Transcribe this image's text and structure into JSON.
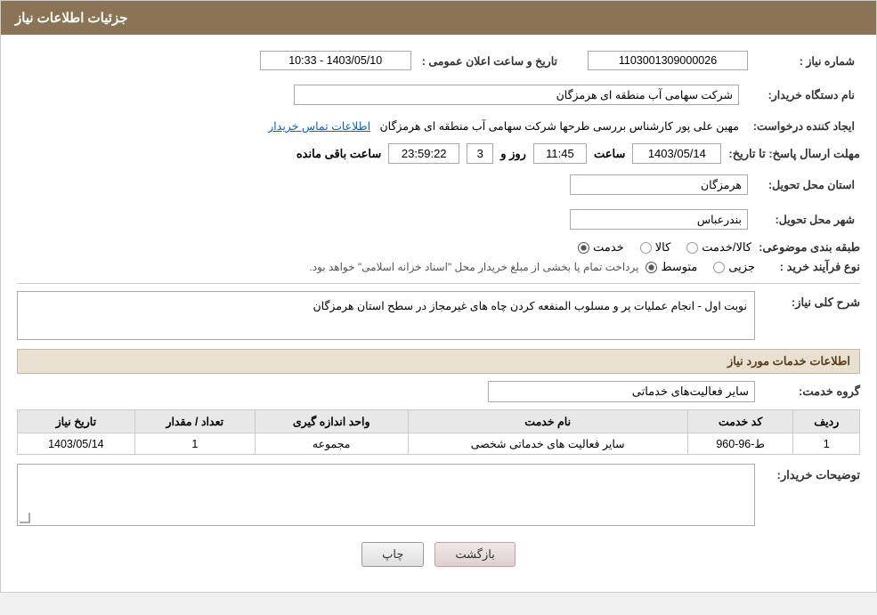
{
  "header": {
    "title": "جزئیات اطلاعات نیاز"
  },
  "fields": {
    "need_number_label": "شماره نیاز :",
    "need_number_value": "1103001309000026",
    "buyer_org_label": "نام دستگاه خریدار:",
    "buyer_org_value": "شرکت سهامی  آب منطقه ای هرمزگان",
    "creator_label": "ایجاد کننده درخواست:",
    "creator_value": "مهین علی پور کارشناس بررسی طرحها شرکت سهامی  آب منطقه ای هرمزگان",
    "creator_link": "اطلاعات تماس خریدار",
    "announce_date_label": "تاریخ و ساعت اعلان عمومی :",
    "announce_date_value": "1403/05/10 - 10:33",
    "deadline_label": "مهلت ارسال پاسخ: تا تاریخ:",
    "deadline_date": "1403/05/14",
    "deadline_time_label": "ساعت",
    "deadline_time": "11:45",
    "remaining_days_label": "روز و",
    "remaining_days": "3",
    "remaining_time": "23:59:22",
    "remaining_suffix": "ساعت باقی مانده",
    "province_label": "استان محل تحویل:",
    "province_value": "هرمزگان",
    "city_label": "شهر محل تحویل:",
    "city_value": "بندرعباس",
    "category_label": "طبقه بندی موضوعی:",
    "category_options": [
      "کالا",
      "خدمت",
      "کالا/خدمت"
    ],
    "category_selected": "خدمت",
    "process_label": "نوع فرآیند خرید :",
    "process_options": [
      "جزیی",
      "متوسط"
    ],
    "process_note": "پرداخت تمام یا بخشی از مبلغ خریدار محل \"اسناد خزانه اسلامی\" خواهد بود.",
    "description_label": "شرح کلی نیاز:",
    "description_value": "نوبت اول - انجام عملیات پر و مسلوب المنفعه کردن چاه های غیرمجاز در سطح استان هرمزگان",
    "services_section_title": "اطلاعات خدمات مورد نیاز",
    "service_group_label": "گروه خدمت:",
    "service_group_value": "سایر فعالیت‌های خدماتی",
    "grid": {
      "columns": [
        "ردیف",
        "کد خدمت",
        "نام خدمت",
        "واحد اندازه گیری",
        "تعداد / مقدار",
        "تاریخ نیاز"
      ],
      "rows": [
        {
          "row": "1",
          "code": "ط-96-960",
          "name": "سایر فعالیت های خدماتی شخصی",
          "unit": "مجموعه",
          "qty": "1",
          "date": "1403/05/14"
        }
      ]
    },
    "buyer_desc_label": "توضیحات خریدار:",
    "buyer_desc_value": ""
  },
  "buttons": {
    "print": "چاپ",
    "back": "بازگشت"
  }
}
